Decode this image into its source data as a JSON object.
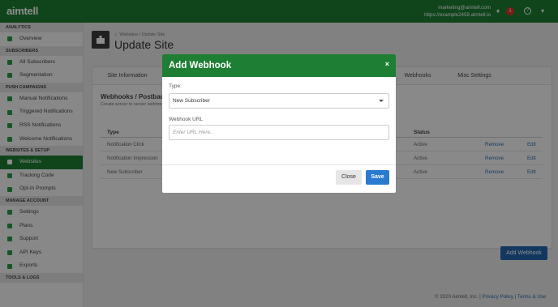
{
  "topbar": {
    "logo": "aimtell",
    "account_email": "marketing@aimtell.com",
    "account_site": "https://example2459.aimtell.io",
    "notification_count": "1",
    "help": "?"
  },
  "sidebar": {
    "sections": [
      {
        "title": "ANALYTICS",
        "items": [
          "Overview"
        ]
      },
      {
        "title": "SUBSCRIBERS",
        "items": [
          "All Subscribers",
          "Segmentation"
        ]
      },
      {
        "title": "PUSH CAMPAIGNS",
        "items": [
          "Manual Notifications",
          "Triggered Notifications",
          "RSS Notifications",
          "Welcome Notifications"
        ]
      },
      {
        "title": "WEBSITES & SETUP",
        "items": [
          "Websites",
          "Tracking Code",
          "Opt-In Prompts"
        ]
      },
      {
        "title": "MANAGE ACCOUNT",
        "items": [
          "Settings",
          "Plans",
          "Support",
          "API Keys",
          "Exports"
        ]
      },
      {
        "title": "TOOLS & LOGS",
        "items": []
      }
    ],
    "active_item": "Websites"
  },
  "page": {
    "breadcrumb_home": "⌂",
    "breadcrumb_websites": "Websites",
    "breadcrumb_sep": "/",
    "breadcrumb_current": "Update Site",
    "title": "Update Site"
  },
  "tabs": [
    "Site Information",
    "Webhooks",
    "Misc Settings"
  ],
  "webhooks": {
    "title": "Webhooks / Postback",
    "subtitle": "Create server to server webhooks",
    "columns": [
      "Type",
      "Status"
    ],
    "rows": [
      {
        "type": "Notification Click",
        "status": "Active",
        "remove": "Remove",
        "edit": "Edit"
      },
      {
        "type": "Notification Impression",
        "status": "Active",
        "remove": "Remove",
        "edit": "Edit"
      },
      {
        "type": "New Subscriber",
        "status": "Active",
        "remove": "Remove",
        "edit": "Edit"
      }
    ],
    "add_button": "Add Webhook"
  },
  "footer": {
    "copyright": "© 2020 Aimtell, Inc. | ",
    "privacy": "Privacy Policy",
    "sep": " | ",
    "terms": "Terms & Use"
  },
  "modal": {
    "title": "Add Webhook",
    "close_glyph": "×",
    "type_label": "Type:",
    "type_value": "New Subscriber",
    "url_label": "Webhook URL",
    "url_placeholder": "Enter URL Here..",
    "close_button": "Close",
    "save_button": "Save"
  },
  "colors": {
    "brand_green": "#1e7f34",
    "save_blue": "#2a7ad0",
    "add_blue": "#2366b0",
    "link_blue": "#2b6fb6",
    "badge_red": "#d9342b"
  }
}
